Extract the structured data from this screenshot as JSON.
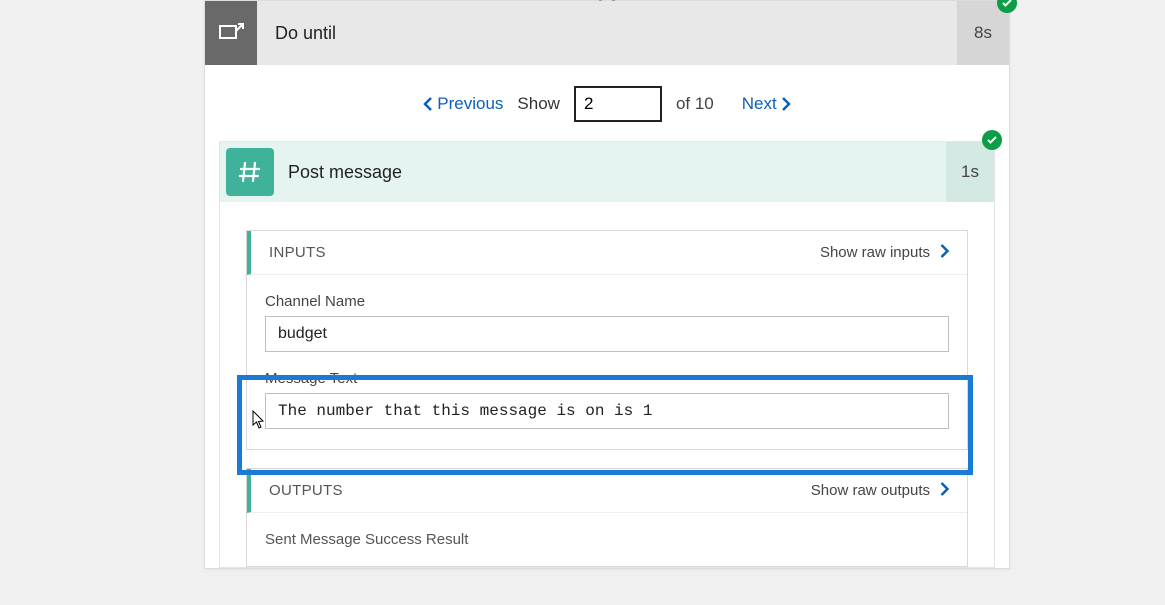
{
  "do_until": {
    "title": "Do until",
    "duration": "8s"
  },
  "pager": {
    "previous_label": "Previous",
    "show_label": "Show",
    "value": "2",
    "of_label": "of 10",
    "next_label": "Next"
  },
  "post_message": {
    "title": "Post message",
    "duration": "1s"
  },
  "inputs_section": {
    "title": "INPUTS",
    "raw_link": "Show raw inputs",
    "channel_label": "Channel Name",
    "channel_value": "budget",
    "message_label": "Message Text",
    "message_value": "The number that this message is on is 1"
  },
  "outputs_section": {
    "title": "OUTPUTS",
    "raw_link": "Show raw outputs",
    "sent_label": "Sent Message Success Result"
  }
}
